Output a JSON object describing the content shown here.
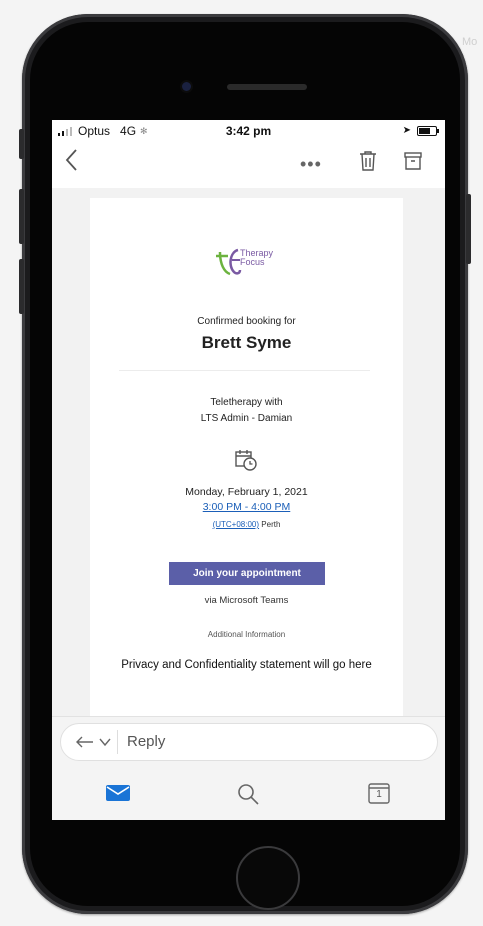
{
  "overlay": {
    "ghost_text": "Mo"
  },
  "status_bar": {
    "carrier": "Optus",
    "network": "4G",
    "time": "3:42 pm"
  },
  "toolbar": {
    "back_icon": "chevron-left-icon",
    "more_label": "•••",
    "delete_icon": "trash-icon",
    "archive_icon": "archive-icon"
  },
  "email": {
    "brand": {
      "logo_line1": "Therapy",
      "logo_line2": "Focus"
    },
    "confirm_text": "Confirmed booking for",
    "client_name": "Brett Syme",
    "service_line1": "Teletherapy with",
    "service_line2": "LTS Admin - Damian",
    "date": "Monday, February 1, 2021",
    "time_range": "3:00 PM - 4:00 PM",
    "timezone_offset": "(UTC+08:00)",
    "timezone_city": "Perth",
    "join_button": "Join your appointment",
    "via": "via Microsoft Teams",
    "additional_heading": "Additional Information",
    "privacy_text": "Privacy and Confidentiality statement will go here"
  },
  "reply": {
    "placeholder": "Reply"
  },
  "tabbar": {
    "calendar_day": "1"
  },
  "colors": {
    "accent": "#5b5fa8",
    "link": "#1b5fb8",
    "mail_active": "#1a74d6",
    "brand_purple": "#7a5aa3",
    "brand_green": "#6cb33f"
  }
}
